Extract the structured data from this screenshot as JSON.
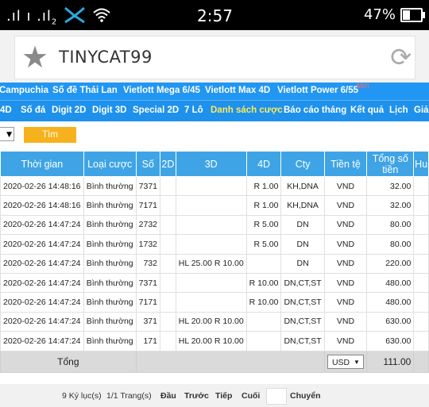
{
  "status": {
    "signal": ".ıl ı .ıl",
    "sim": "2",
    "time": "2:57",
    "battery_text": "47%",
    "battery_level": 0.47
  },
  "browser": {
    "title": "TINYCAT99",
    "star_icon": "star-icon",
    "reload_icon": "reload-icon"
  },
  "nav1": {
    "items": [
      "Campuchia",
      "Số đề Thái Lan",
      "Vietlott Mega 6/45",
      "Vietlott Max 4D",
      "Vietlott Power 6/55"
    ],
    "badge": "Mới"
  },
  "nav2": {
    "items": [
      "4D",
      "Số đá",
      "Digit 2D",
      "Digit 3D",
      "Special 2D",
      "7 Lô",
      "Danh sách cược",
      "Báo cáo tháng",
      "Kết quả",
      "Lịch",
      "Giả"
    ],
    "active": "Danh sách cược"
  },
  "filter": {
    "select_arrow": "▼",
    "search_label": "Tìm"
  },
  "table": {
    "headers": [
      "Thời gian",
      "Loại cược",
      "Số",
      "2D",
      "3D",
      "4D",
      "Cty",
      "Tiền tệ",
      "Tổng số tiền",
      "Hu"
    ],
    "rows": [
      [
        "2020-02-26 14:48:16",
        "Bình thường",
        "7371",
        "",
        "",
        "R 1.00",
        "KH,DNA",
        "VND",
        "32.00"
      ],
      [
        "2020-02-26 14:48:16",
        "Bình thường",
        "7171",
        "",
        "",
        "R 1.00",
        "KH,DNA",
        "VND",
        "32.00"
      ],
      [
        "2020-02-26 14:47:24",
        "Bình thường",
        "2732",
        "",
        "",
        "R 5.00",
        "DN",
        "VND",
        "80.00"
      ],
      [
        "2020-02-26 14:47:24",
        "Bình thường",
        "1732",
        "",
        "",
        "R 5.00",
        "DN",
        "VND",
        "80.00"
      ],
      [
        "2020-02-26 14:47:24",
        "Bình thường",
        "732",
        "",
        "HL 25.00 R 10.00",
        "",
        "DN",
        "VND",
        "220.00"
      ],
      [
        "2020-02-26 14:47:24",
        "Bình thường",
        "7371",
        "",
        "",
        "R 10.00",
        "DN,CT,ST",
        "VND",
        "480.00"
      ],
      [
        "2020-02-26 14:47:24",
        "Bình thường",
        "7171",
        "",
        "",
        "R 10.00",
        "DN,CT,ST",
        "VND",
        "480.00"
      ],
      [
        "2020-02-26 14:47:24",
        "Bình thường",
        "371",
        "",
        "HL 20.00 R 10.00",
        "",
        "DN,CT,ST",
        "VND",
        "630.00"
      ],
      [
        "2020-02-26 14:47:24",
        "Bình thường",
        "171",
        "",
        "HL 20.00 R 10.00",
        "",
        "DN,CT,ST",
        "VND",
        "630.00"
      ]
    ],
    "total_label": "Tổng",
    "total_currency": "USD",
    "total_amount": "111.00"
  },
  "pager": {
    "records": "9 Ký lục(s)",
    "pages": "1/1 Trang(s)",
    "first": "Đầu",
    "prev": "Trước",
    "next": "Tiếp",
    "last": "Cuối",
    "go": "Chuyển"
  }
}
